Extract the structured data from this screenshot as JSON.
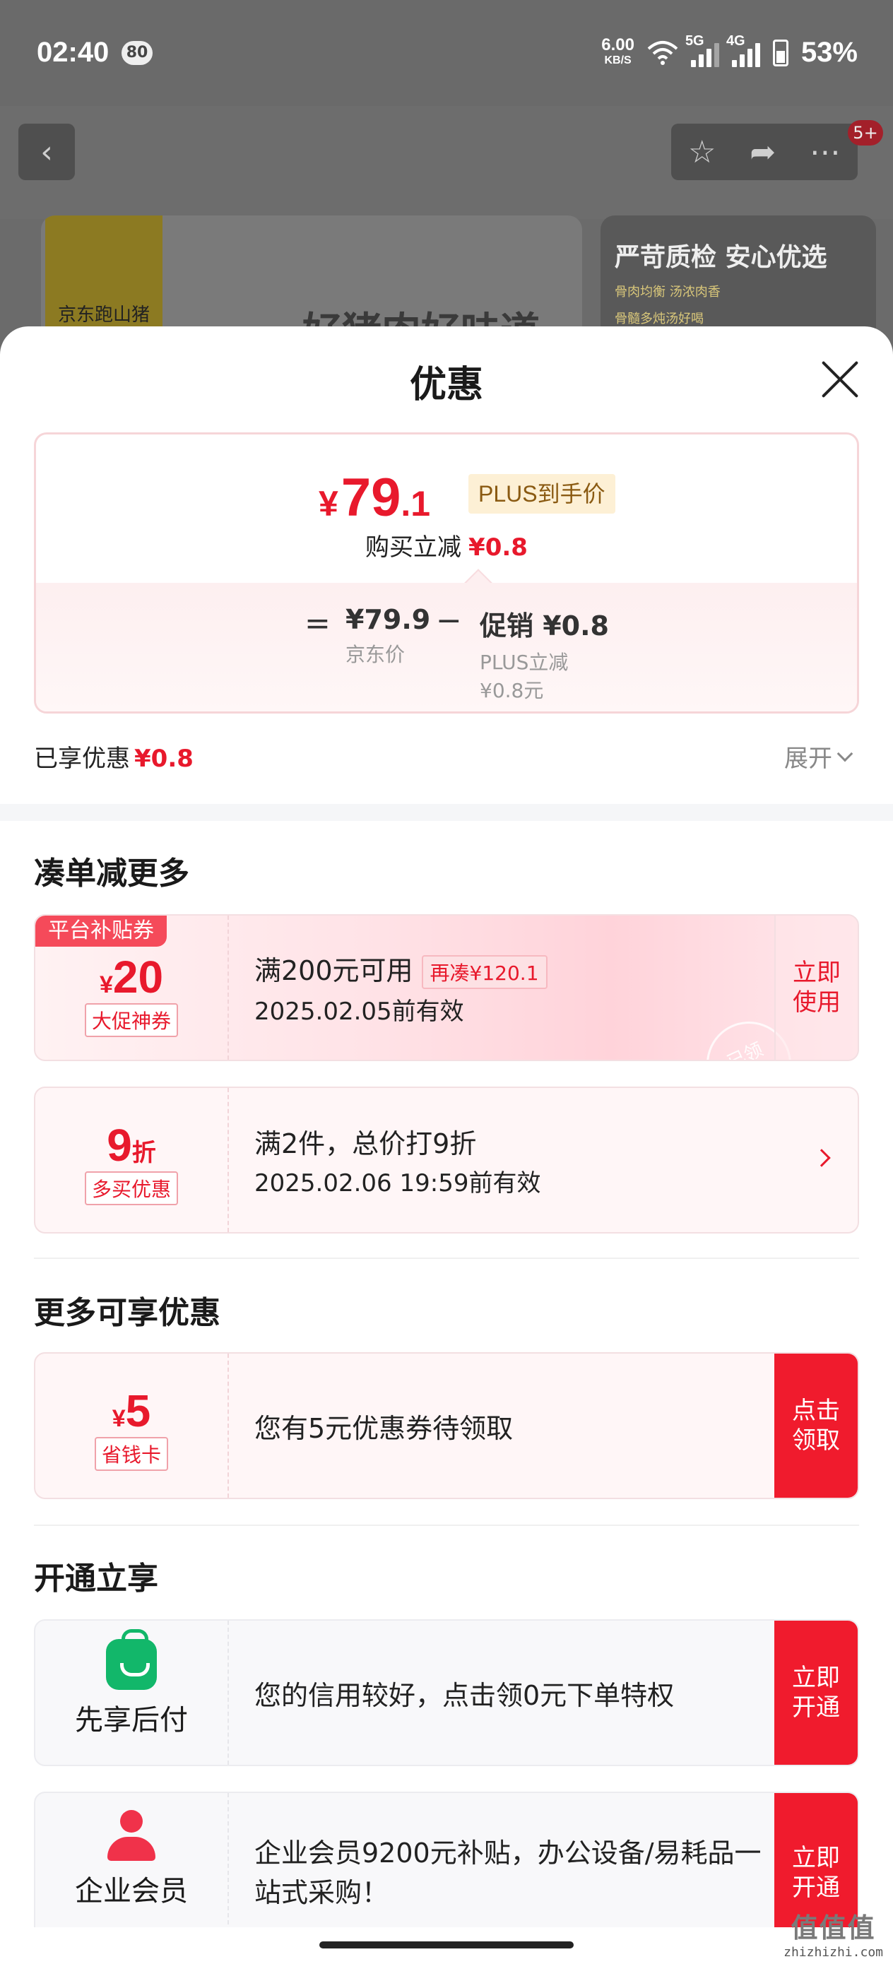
{
  "status_bar": {
    "time": "02:40",
    "badge": "80",
    "speed": "6.00",
    "speed_unit": "KB/S",
    "net1": "5G",
    "net2": "4G",
    "battery": "53%"
  },
  "background": {
    "cart_count": "5+",
    "banner1_text": "好猪肉好味道",
    "logo_text": "京东跑山猪",
    "banner2_title": "严苛质检 安心优选",
    "banner2_chip1": "骨肉均衡 汤浓肉香",
    "banner2_chip2": "骨髓多炖汤好喝"
  },
  "sheet": {
    "title": "优惠",
    "price": {
      "yen": "¥",
      "int": "79",
      "dec": ".1",
      "tag": "PLUS到手价",
      "sub_label": "购买立减",
      "sub_value": "¥0.8"
    },
    "formula": {
      "eq": "=",
      "jd_price": "¥79.9",
      "jd_label": "京东价",
      "minus": "−",
      "promo": "促销 ¥0.8",
      "promo_detail1": "PLUS立减",
      "promo_detail2": "¥0.8元"
    },
    "enjoyed": {
      "label": "已享优惠",
      "value": "¥0.8",
      "expand": "展开"
    },
    "section1": {
      "title": "凑单减更多",
      "coupon1": {
        "corner": "平台补贴券",
        "yen": "¥",
        "amount": "20",
        "tag": "大促神券",
        "main": "满200元可用",
        "extra": "再凑¥120.1",
        "date": "2025.02.05前有效",
        "action": "立即使用",
        "stamp": "已领"
      },
      "coupon2": {
        "amount": "9",
        "unit": "折",
        "tag": "多买优惠",
        "main": "满2件，总价打9折",
        "date": "2025.02.06 19:59前有效"
      }
    },
    "section2": {
      "title": "更多可享优惠",
      "card": {
        "yen": "¥",
        "amount": "5",
        "tag": "省钱卡",
        "main": "您有5元优惠券待领取",
        "action": "点击领取"
      }
    },
    "section3": {
      "title": "开通立享",
      "svc1": {
        "name": "先享后付",
        "icon": "shopping-bag-icon",
        "desc": "您的信用较好，点击领0元下单特权",
        "action": "立即开通"
      },
      "svc2": {
        "name": "企业会员",
        "icon": "person-icon",
        "desc": "企业会员9200元补贴，办公设备/易耗品一站式采购！",
        "action": "立即开通"
      }
    }
  },
  "watermark": {
    "big": "值值值",
    "small": "zhizhizhi.com"
  },
  "colors": {
    "accent": "#e8192c",
    "button_red": "#f01b2d",
    "icon_green": "#12b76a"
  }
}
